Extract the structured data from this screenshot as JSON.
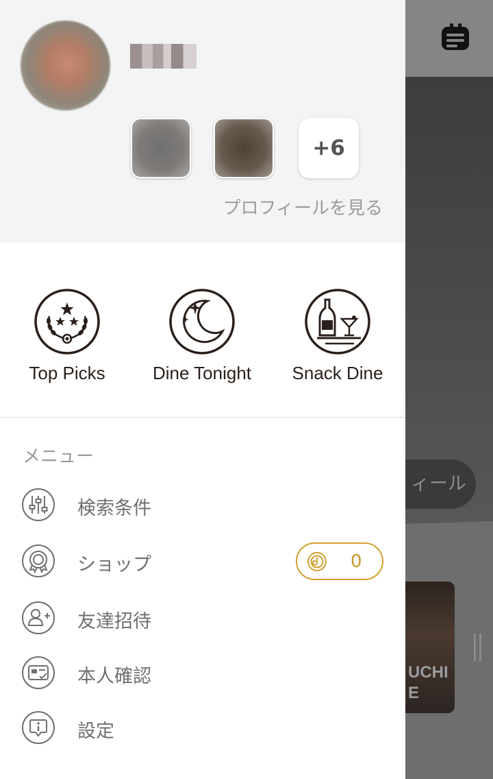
{
  "background": {
    "profile_pill_text": "ィール",
    "card_text": "UCHI\nE"
  },
  "drawer": {
    "username": "",
    "more_photos": "+6",
    "view_profile": "プロフィールを見る",
    "quick_actions": [
      {
        "label": "Top Picks",
        "icon": "laurel-stars-icon"
      },
      {
        "label": "Dine Tonight",
        "icon": "moon-stars-icon"
      },
      {
        "label": "Snack Dine",
        "icon": "bottle-cocktail-icon"
      }
    ],
    "menu": {
      "heading": "メニュー",
      "items": [
        {
          "label": "検索条件",
          "icon": "filter-sliders-icon"
        },
        {
          "label": "ショップ",
          "icon": "shop-badge-icon"
        },
        {
          "label": "友達招待",
          "icon": "add-friend-icon"
        },
        {
          "label": "本人確認",
          "icon": "id-card-icon"
        },
        {
          "label": "設定",
          "icon": "info-settings-icon"
        }
      ]
    },
    "coins": {
      "value": "0",
      "icon": "coin-icon",
      "color": "#d4a02e"
    }
  },
  "colors": {
    "icon_dark": "#2a1f1a",
    "menu_icon": "#6f6f6f",
    "accent_gold": "#d4a02e",
    "header_bg": "#f4f4f4"
  }
}
